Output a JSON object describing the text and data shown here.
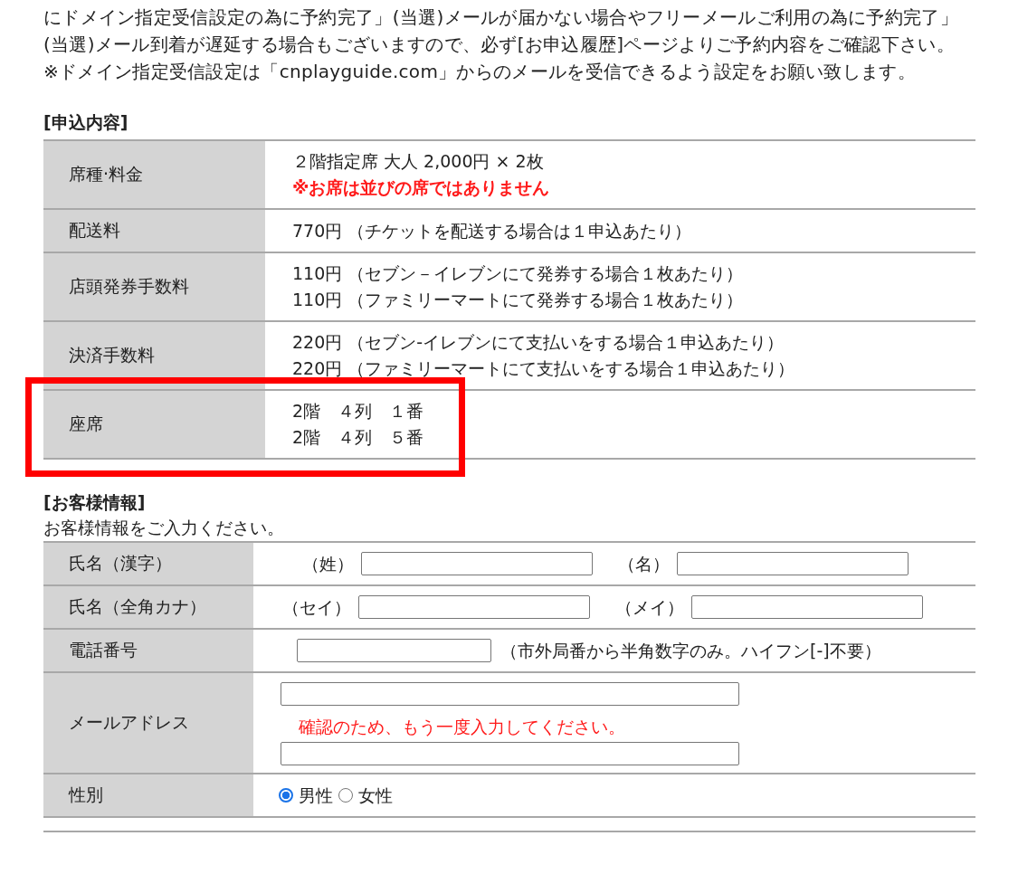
{
  "notice": "にドメイン指定受信設定の為に予約完了」(当選)メールが届かない場合やフリーメールご利用の為に予約完了」(当選)メール到着が遅延する場合もございますので、必ず[お申込履歴]ページよりご予約内容をご確認下さい。 ※ドメイン指定受信設定は「cnplayguide.com」からのメールを受信できるよう設定をお願い致します。",
  "application": {
    "heading": "[申込内容]",
    "rows": [
      {
        "label": "席種·料金",
        "highlighted": false,
        "lines": [
          {
            "text": "２階指定席 大人 2,000円 × 2枚",
            "kind": "plain"
          },
          {
            "text": "※お席は並びの席ではありません",
            "kind": "warning"
          }
        ]
      },
      {
        "label": "配送料",
        "highlighted": false,
        "lines": [
          {
            "text": "770円 （チケットを配送する場合は１申込あたり）",
            "kind": "plain"
          }
        ]
      },
      {
        "label": "店頭発券手数料",
        "highlighted": false,
        "lines": [
          {
            "text": "110円 （セブン－イレブンにて発券する場合１枚あたり）",
            "kind": "plain"
          },
          {
            "text": "110円 （ファミリーマートにて発券する場合１枚あたり）",
            "kind": "plain"
          }
        ]
      },
      {
        "label": "決済手数料",
        "highlighted": false,
        "lines": [
          {
            "text": "220円 （セブン-イレブンにて支払いをする場合１申込あたり）",
            "kind": "plain"
          },
          {
            "text": "220円 （ファミリーマートにて支払いをする場合１申込あたり）",
            "kind": "plain"
          }
        ]
      },
      {
        "label": "座席",
        "highlighted": true,
        "lines": [
          {
            "text": "2階　４列　１番",
            "kind": "plain"
          },
          {
            "text": "2階　４列　５番",
            "kind": "plain"
          }
        ]
      }
    ]
  },
  "customer": {
    "heading": "[お客様情報]",
    "intro": "お客様情報をご入力ください。",
    "rows": [
      {
        "kind": "name_pair",
        "label": "氏名（漢字）",
        "fields": [
          {
            "prefix": "（姓）"
          },
          {
            "prefix": "（名）"
          }
        ]
      },
      {
        "kind": "name_pair",
        "label": "氏名（全角カナ）",
        "fields": [
          {
            "prefix": "（セイ）"
          },
          {
            "prefix": "（メイ）"
          }
        ]
      },
      {
        "kind": "phone",
        "label": "電話番号",
        "note": "（市外局番から半角数字のみ。ハイフン[-]不要）"
      },
      {
        "kind": "email",
        "label": "メールアドレス",
        "confirm_note": "確認のため、もう一度入力してください。"
      },
      {
        "kind": "radio",
        "label": "性別",
        "options": [
          {
            "label": "男性",
            "selected": true
          },
          {
            "label": "女性",
            "selected": false
          }
        ]
      }
    ]
  }
}
